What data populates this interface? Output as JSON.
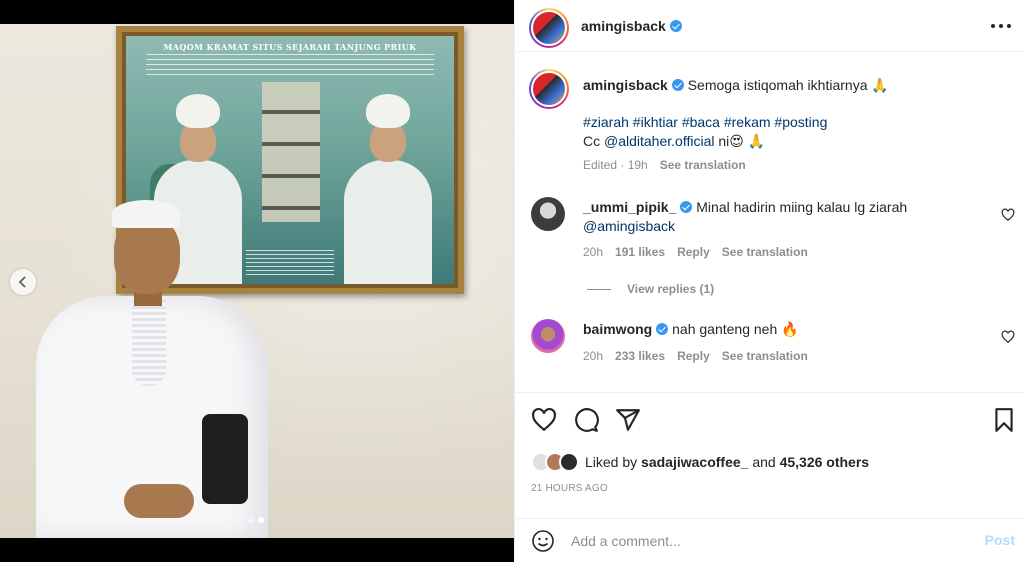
{
  "post": {
    "username": "amingisback",
    "verified": true,
    "more_icon": "more-horizontal-icon"
  },
  "media": {
    "poster_title": "MAQOM KRAMAT SITUS SEJARAH TANJUNG PRIUK",
    "slide_count": 2,
    "active_slide": 2,
    "prev_icon": "chevron-left-icon"
  },
  "caption": {
    "username": "amingisback",
    "text": "Semoga istiqomah ikhtiarnya 🙏",
    "hashtags": "#ziarah #ikhtiar #baca #rekam #posting",
    "cc_prefix": "Cc ",
    "cc_mention": "@alditaher.official",
    "cc_suffix": " ni😍 🙏",
    "edited": "Edited · 19h",
    "see_translation": "See translation"
  },
  "comments": [
    {
      "username": "_ummi_pipik_",
      "verified": true,
      "text": "Minal hadirin miing kalau lg ziarah",
      "mention": "@amingisback",
      "time": "20h",
      "likes": "191 likes",
      "reply": "Reply",
      "see_translation": "See translation",
      "view_replies": "View replies (1)"
    },
    {
      "username": "baimwong",
      "verified": true,
      "text": "nah ganteng neh 🔥",
      "time": "20h",
      "likes": "233 likes",
      "reply": "Reply",
      "see_translation": "See translation"
    }
  ],
  "actions": {
    "like_icon": "heart-icon",
    "comment_icon": "comment-icon",
    "share_icon": "send-icon",
    "save_icon": "bookmark-icon"
  },
  "likes": {
    "prefix": "Liked by ",
    "user": "sadajiwacoffee_",
    "middle": " and ",
    "count": "45,326 others"
  },
  "timestamp": "21 HOURS AGO",
  "comment_input": {
    "placeholder": "Add a comment...",
    "post_label": "Post",
    "emoji_icon": "emoji-icon"
  },
  "colors": {
    "verified": "#3897f0",
    "link": "#00376b",
    "muted": "#8e8e8e",
    "post_disabled": "#b3dbff"
  }
}
